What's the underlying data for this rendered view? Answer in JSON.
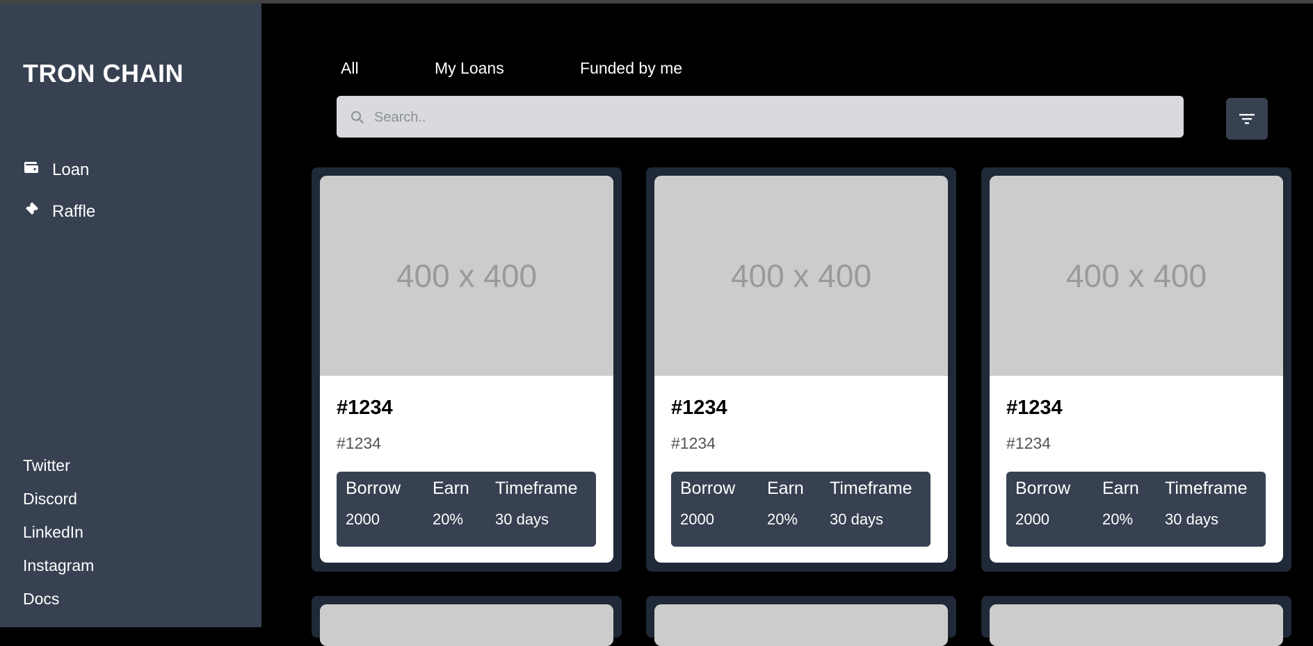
{
  "app": {
    "brand": "TRON CHAIN"
  },
  "sidebar": {
    "nav": [
      {
        "label": "Loan",
        "icon": "wallet-icon"
      },
      {
        "label": "Raffle",
        "icon": "ticket-icon"
      }
    ],
    "social": [
      "Twitter",
      "Discord",
      "LinkedIn",
      "Instagram",
      "Docs"
    ]
  },
  "tabs": [
    "All",
    "My Loans",
    "Funded by me"
  ],
  "search": {
    "placeholder": "Search..",
    "value": ""
  },
  "filter": {
    "icon": "filter-icon"
  },
  "cards": [
    {
      "image_text": "400 x 400",
      "title": "#1234",
      "subtitle": "#1234",
      "stats": {
        "headers": [
          "Borrow",
          "Earn",
          "Timeframe"
        ],
        "values": [
          "2000",
          "20%",
          "30 days"
        ]
      }
    },
    {
      "image_text": "400 x 400",
      "title": "#1234",
      "subtitle": "#1234",
      "stats": {
        "headers": [
          "Borrow",
          "Earn",
          "Timeframe"
        ],
        "values": [
          "2000",
          "20%",
          "30 days"
        ]
      }
    },
    {
      "image_text": "400 x 400",
      "title": "#1234",
      "subtitle": "#1234",
      "stats": {
        "headers": [
          "Borrow",
          "Earn",
          "Timeframe"
        ],
        "values": [
          "2000",
          "20%",
          "30 days"
        ]
      }
    }
  ],
  "colors": {
    "sidebar_bg": "#374151",
    "main_bg": "#000000",
    "card_frame": "#1f2937",
    "image_placeholder": "#cccccc",
    "stats_bg": "#374151",
    "search_bg": "#d9dadd"
  }
}
